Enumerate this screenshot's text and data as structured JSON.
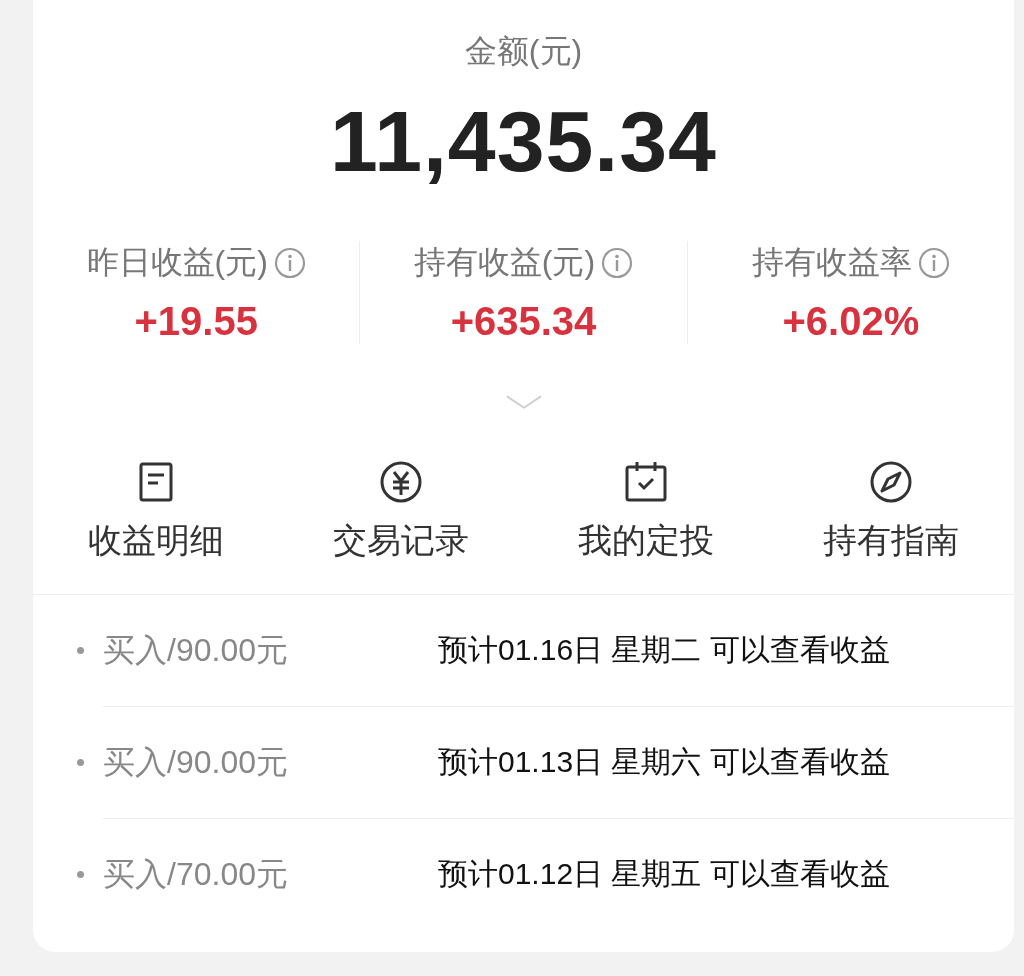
{
  "balance": {
    "label": "金额(元)",
    "amount": "11,435.34"
  },
  "stats": [
    {
      "label": "昨日收益(元)",
      "value": "+19.55"
    },
    {
      "label": "持有收益(元)",
      "value": "+635.34"
    },
    {
      "label": "持有收益率",
      "value": "+6.02%"
    }
  ],
  "actions": [
    {
      "label": "收益明细"
    },
    {
      "label": "交易记录"
    },
    {
      "label": "我的定投"
    },
    {
      "label": "持有指南"
    }
  ],
  "records": [
    {
      "action": "买入/90.00元",
      "note": "预计01.16日 星期二 可以查看收益"
    },
    {
      "action": "买入/90.00元",
      "note": "预计01.13日 星期六 可以查看收益"
    },
    {
      "action": "买入/70.00元",
      "note": "预计01.12日 星期五 可以查看收益"
    }
  ]
}
